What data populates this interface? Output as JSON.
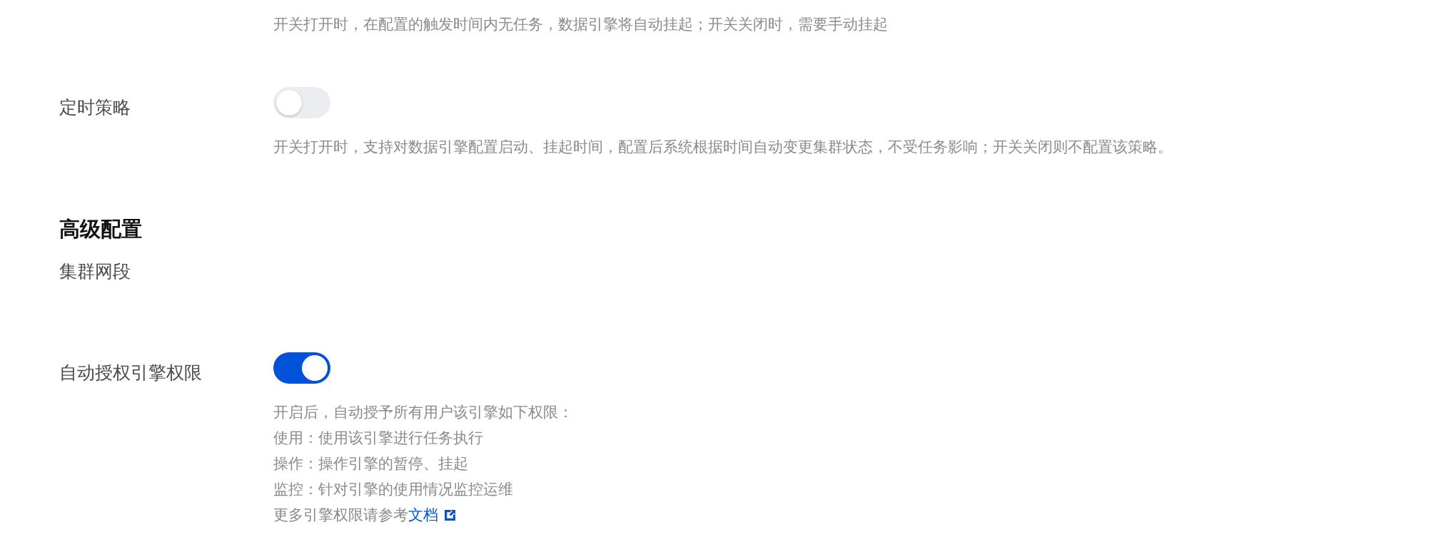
{
  "sections": [
    {
      "kind": "note",
      "description": [
        {
          "text": "开关打开时，在配置的触发时间内无任务，数据引擎将自动挂起；开关关闭时，需要手动挂起"
        }
      ]
    },
    {
      "kind": "switch",
      "label": "定时策略",
      "on": false,
      "description": [
        {
          "text": "开关打开时，支持对数据引擎配置启动、挂起时间，配置后系统根据时间自动变更集群状态，不受任务影响；开关关闭则不配置该策略。"
        }
      ]
    },
    {
      "kind": "heading",
      "title": "高级配置"
    },
    {
      "kind": "field",
      "label": "集群网段"
    },
    {
      "kind": "switch",
      "label": "自动授权引擎权限",
      "on": true,
      "description": [
        {
          "text": "开启后，自动授予所有用户该引擎如下权限："
        },
        {
          "text": "使用：使用该引擎进行任务执行"
        },
        {
          "text": "操作：操作引擎的暂停、挂起"
        },
        {
          "text": "监控：针对引擎的使用情况监控运维"
        },
        {
          "text": "更多引擎权限请参考",
          "link": "文档"
        }
      ]
    }
  ]
}
